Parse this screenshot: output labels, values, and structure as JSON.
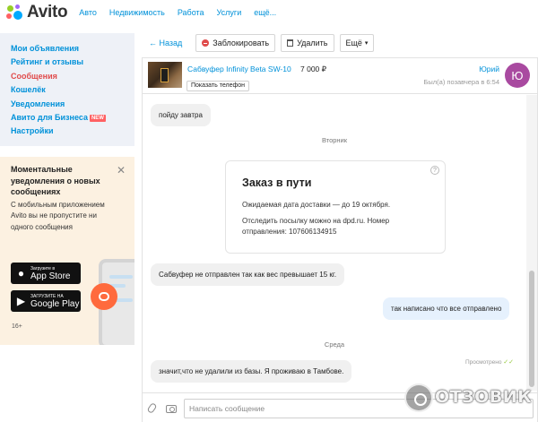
{
  "topnav": {
    "logo_text": "Avito",
    "items": [
      "Авто",
      "Недвижимость",
      "Работа",
      "Услуги",
      "ещё..."
    ]
  },
  "sidebar": {
    "items": [
      {
        "label": "Мои объявления"
      },
      {
        "label": "Рейтинг и отзывы"
      },
      {
        "label": "Сообщения",
        "active": true
      },
      {
        "label": "Кошелёк"
      },
      {
        "label": "Уведомления"
      },
      {
        "label": "Авито для Бизнеса",
        "badge": "NEW"
      },
      {
        "label": "Настройки"
      }
    ]
  },
  "promo": {
    "title": "Моментальные уведомления о новых сообщениях",
    "text": "С мобильным приложением Avito вы не пропустите ни одного сообщения",
    "appstore_small": "Загрузите в",
    "appstore_big": "App Store",
    "googleplay_small": "ЗАГРУЗИТЕ НА",
    "googleplay_big": "Google Play",
    "age_rating": "16+"
  },
  "toolbar": {
    "back_label": "← Назад",
    "block_label": "Заблокировать",
    "delete_label": "Удалить",
    "more_label": "Ещё"
  },
  "chat_header": {
    "item_title": "Сабвуфер Infinity Beta SW-10",
    "item_price": "7 000 ₽",
    "show_phone_label": "Показать телефон",
    "user_name": "Юрий",
    "last_seen": "Был(а) позавчера в 6:54",
    "avatar_letter": "Ю"
  },
  "messages": {
    "m1": "пойду завтра",
    "day_tuesday": "Вторник",
    "order": {
      "title": "Заказ в пути",
      "line1": "Ожидаемая дата доставки — до 19 октября.",
      "line2": "Отследить посылку можно на dpd.ru. Номер",
      "line3": "отправления: 107606134915",
      "help": "?"
    },
    "m2": "Сабвуфер  не отправлен так как вес превышает 15 кг.",
    "m3": "так написано что все отправлено",
    "read_status": "Просмотрено",
    "read_checks": "✓✓",
    "day_wednesday": "Среда",
    "m4": "значит,что не удалили из базы. Я проживаю в Тамбове."
  },
  "composer": {
    "placeholder": "Написать сообщение"
  },
  "watermark": {
    "text": "ОТЗОВИК"
  },
  "colors": {
    "link": "#0091d9",
    "active_menu": "#e04b4b",
    "sidebar_bg": "#eef1f7",
    "promo_bg": "#fcf1e1",
    "outgoing_bubble": "#e6f1fd",
    "incoming_bubble": "#f0f0f0",
    "avatar": "#a94aa0"
  }
}
